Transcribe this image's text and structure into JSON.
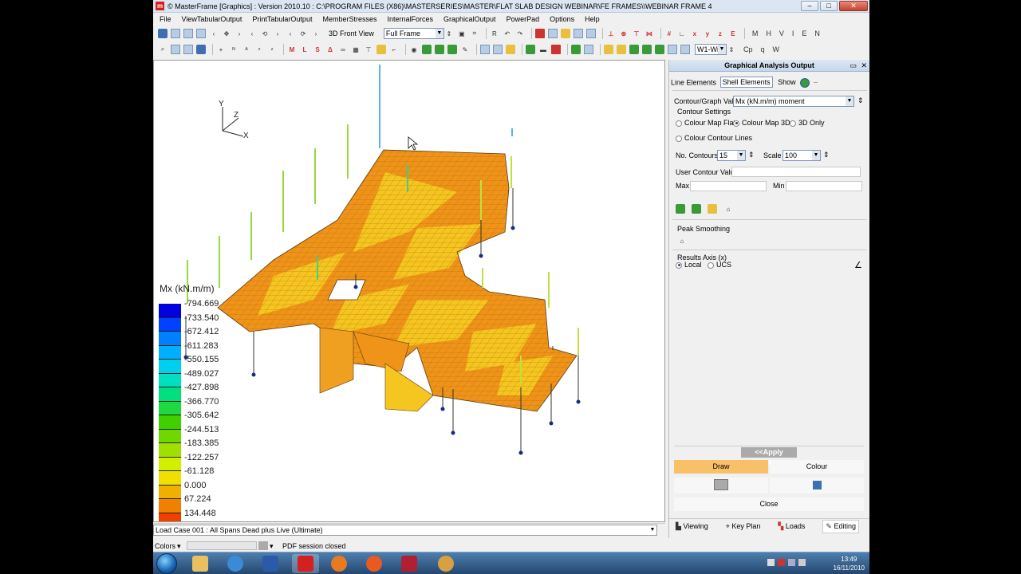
{
  "window": {
    "title": "© MasterFrame [Graphics] : Version 2010.10 : C:\\PROGRAM FILES (X86)\\MASTERSERIES\\MASTER\\FLAT SLAB DESIGN WEBINAR\\FE FRAMES\\\\WEBINAR FRAME 4"
  },
  "menu": [
    "File",
    "ViewTabularOutput",
    "PrintTabularOutput",
    "MemberStresses",
    "InternalForces",
    "GraphicalOutput",
    "PowerPad",
    "Options",
    "Help"
  ],
  "toolbar": {
    "view_label": "3D Front View",
    "frame_combo": "Full Frame",
    "letters": [
      "M",
      "H",
      "V",
      "I",
      "E",
      "N"
    ],
    "letters2": [
      "Cp",
      "q",
      "W"
    ],
    "combo_w": "W1-Wi"
  },
  "canvas": {
    "axis": {
      "y": "Y",
      "z": "Z",
      "x": "X"
    },
    "legend": {
      "title": "Mx (kN.m/m)",
      "labels": [
        "-794.669",
        "-733.540",
        "-672.412",
        "-611.283",
        "-550.155",
        "-489.027",
        "-427.898",
        "-366.770",
        "-305.642",
        "-244.513",
        "-183.385",
        "-122.257",
        "-61.128",
        "0.000",
        "67.224",
        "134.448"
      ],
      "colors": [
        "#0000e0",
        "#0040ff",
        "#0080ff",
        "#00b0ff",
        "#00d0f0",
        "#00e0c0",
        "#00e080",
        "#20d840",
        "#40d000",
        "#70d800",
        "#a0e000",
        "#d0f000",
        "#f0e000",
        "#f0b000",
        "#f08000",
        "#f04000"
      ]
    }
  },
  "panel": {
    "title": "Graphical Analysis Output",
    "tab_line": "Line Elements",
    "tab_shell": "Shell Elements",
    "show_label": "Show",
    "contour_graph_label": "Contour/Graph Value",
    "contour_graph_value": "Mx (kN.m/m) moment",
    "contour_settings": "Contour Settings",
    "radio_flat": "Colour Map Flat",
    "radio_3d": "Colour Map 3D",
    "radio_3donly": "3D Only",
    "radio_lines": "Colour Contour Lines",
    "no_contours_label": "No. Contours",
    "no_contours_value": "15",
    "scale_label": "Scale",
    "scale_value": "100",
    "user_contour": "User Contour Values",
    "max_label": "Max",
    "min_label": "Min",
    "peak_smoothing": "Peak Smoothing",
    "results_axis": "Results Axis (x)",
    "local": "Local",
    "ucs": "UCS",
    "apply": "<<Apply Settings",
    "draw": "Draw",
    "colour": "Colour",
    "close": "Close",
    "tabs": [
      "Viewing",
      "Key Plan",
      "Loads",
      "Editing"
    ]
  },
  "status": {
    "load_case": "Load Case 001 : All Spans Dead plus Live (Ultimate)",
    "colors": "Colors",
    "pdf": "PDF session closed"
  },
  "taskbar": {
    "time": "13:49",
    "date": "16/11/2010"
  }
}
